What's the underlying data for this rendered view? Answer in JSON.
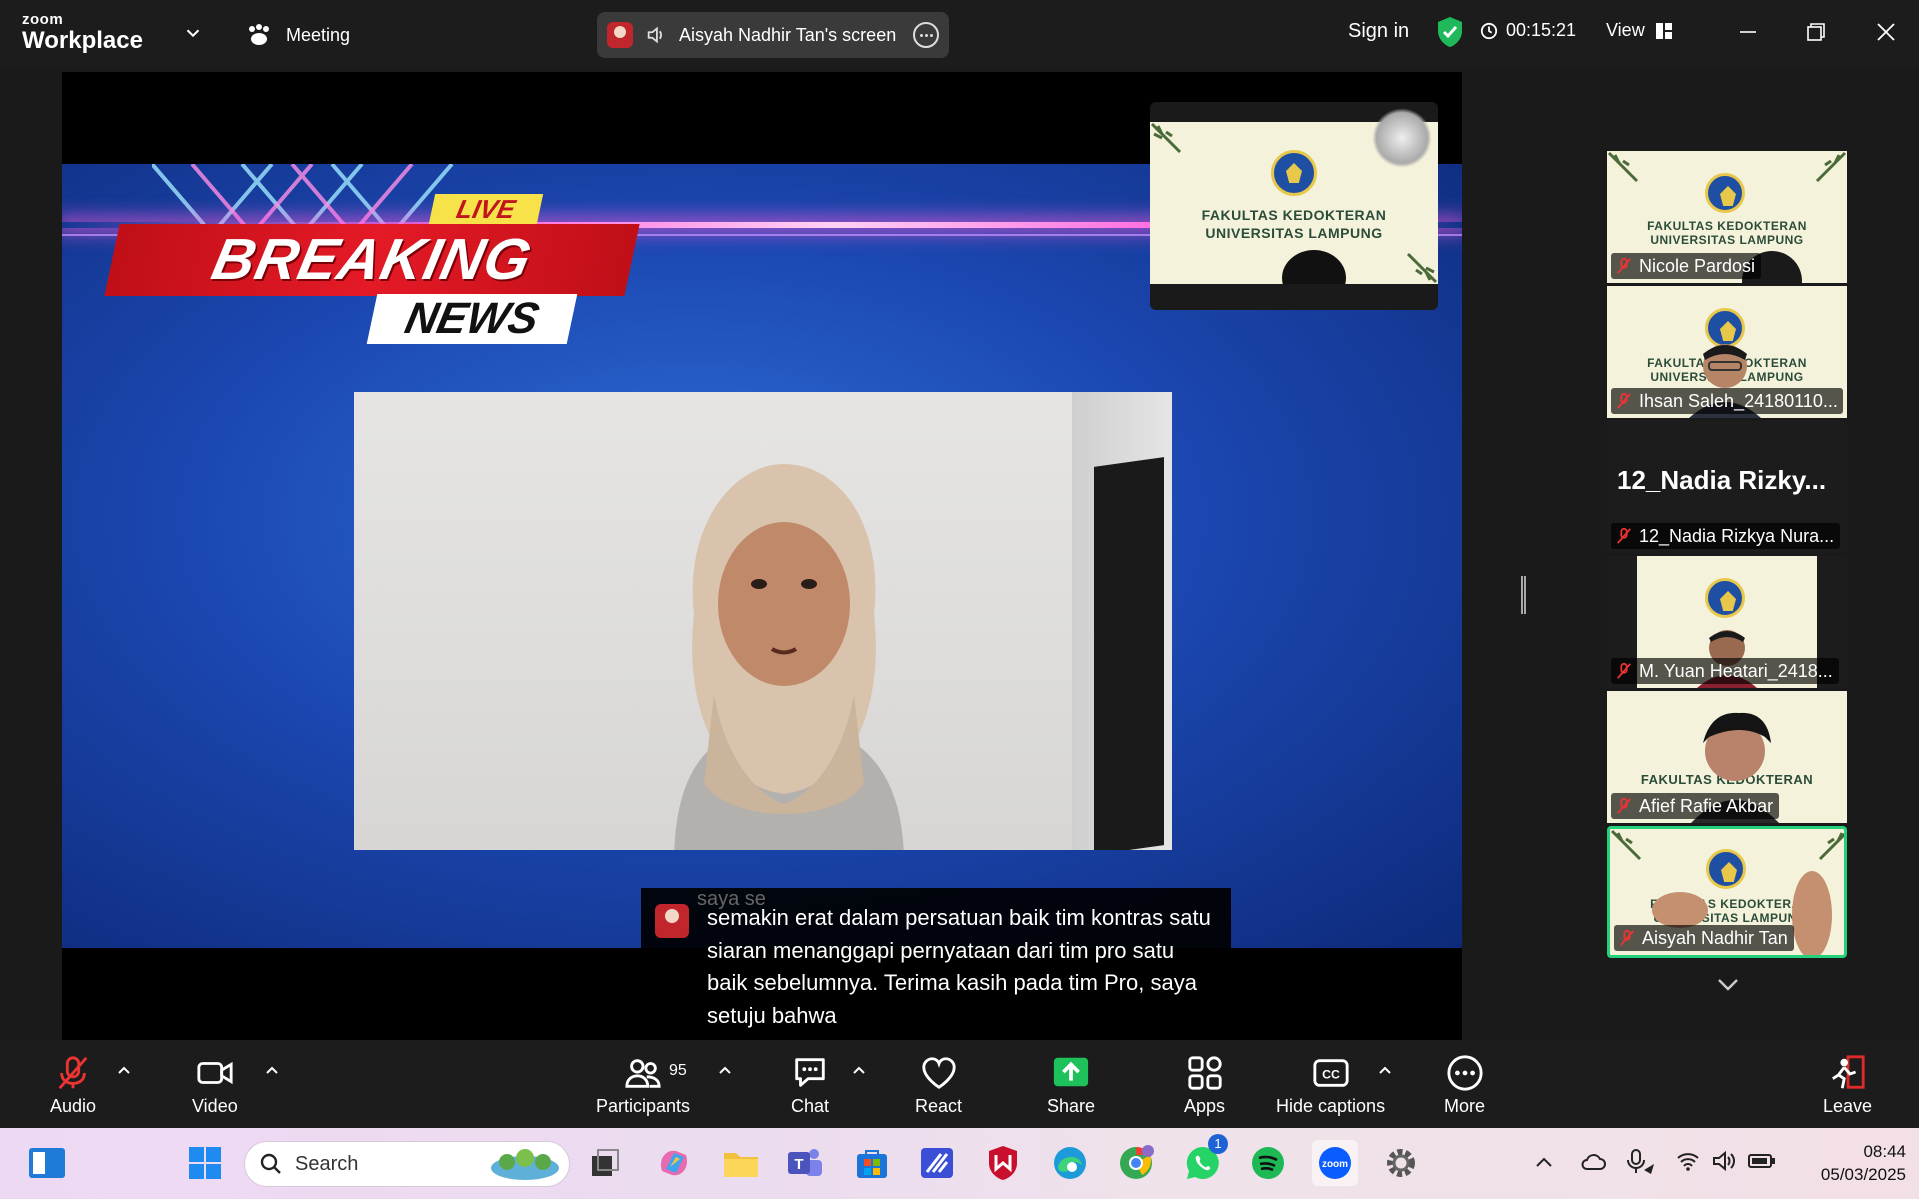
{
  "app": {
    "brand_small": "zoom",
    "brand_big": "Workplace",
    "meeting_label": "Meeting",
    "share_label": "Aisyah Nadhir Tan's screen",
    "sign_in": "Sign in",
    "timer": "00:15:21",
    "view_label": "View"
  },
  "slide": {
    "live": "LIVE",
    "breaking": "BREAKING",
    "news": "NEWS",
    "fk_line1": "FAKULTAS KEDOKTERAN",
    "fk_line2": "UNIVERSITAS LAMPUNG"
  },
  "captions": {
    "faded": "saya se",
    "text": "semakin erat dalam persatuan baik tim kontras satu siaran menanggapi pernyataan dari tim pro satu baik sebelumnya. Terima kasih pada tim Pro, saya setuju bahwa"
  },
  "participants": [
    {
      "name": "Nicole Pardosi"
    },
    {
      "name": "Ihsan Saleh_24180110..."
    },
    {
      "name": "12_Nadia Rizkya Nura...",
      "display": "12_Nadia  Rizky..."
    },
    {
      "name": "M. Yuan Heatari_2418..."
    },
    {
      "name": "Afief Rafie Akbar"
    },
    {
      "name": "Aisyah Nadhir Tan"
    }
  ],
  "toolbar": {
    "audio": "Audio",
    "video": "Video",
    "participants": "Participants",
    "participants_count": "95",
    "chat": "Chat",
    "react": "React",
    "share": "Share",
    "apps": "Apps",
    "hide_captions": "Hide captions",
    "more": "More",
    "leave": "Leave"
  },
  "taskbar": {
    "search_placeholder": "Search",
    "whatsapp_badge": "1",
    "time": "08:44",
    "date": "05/03/2025"
  },
  "colors": {
    "share_green": "#1fc15a",
    "active_border": "#25d07a",
    "shield_green": "#1fb85a",
    "leave_red": "#e02a2a"
  }
}
